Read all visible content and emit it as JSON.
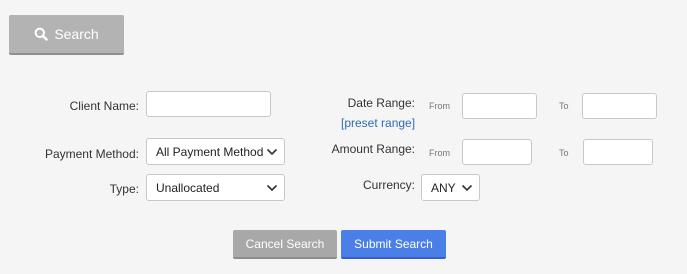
{
  "search_toggle": {
    "label": "Search",
    "icon": "search-icon"
  },
  "fields": {
    "client_name": {
      "label": "Client Name:",
      "value": ""
    },
    "payment_method": {
      "label": "Payment Method:",
      "value": "All Payment Method"
    },
    "type": {
      "label": "Type:",
      "value": "Unallocated"
    },
    "date_range": {
      "label": "Date Range:",
      "from_label": "From",
      "to_label": "To",
      "from_value": "",
      "to_value": "",
      "preset_link": "[preset range]"
    },
    "amount_range": {
      "label": "Amount Range:",
      "from_label": "From",
      "to_label": "To",
      "from_value": "",
      "to_value": ""
    },
    "currency": {
      "label": "Currency:",
      "value": "ANY"
    }
  },
  "actions": {
    "cancel_label": "Cancel Search",
    "submit_label": "Submit Search"
  },
  "colors": {
    "toggle_bg": "#b3b3b3",
    "cancel_bg": "#a8a8a8",
    "submit_bg": "#4a7fe8",
    "link": "#2f6bb5"
  }
}
